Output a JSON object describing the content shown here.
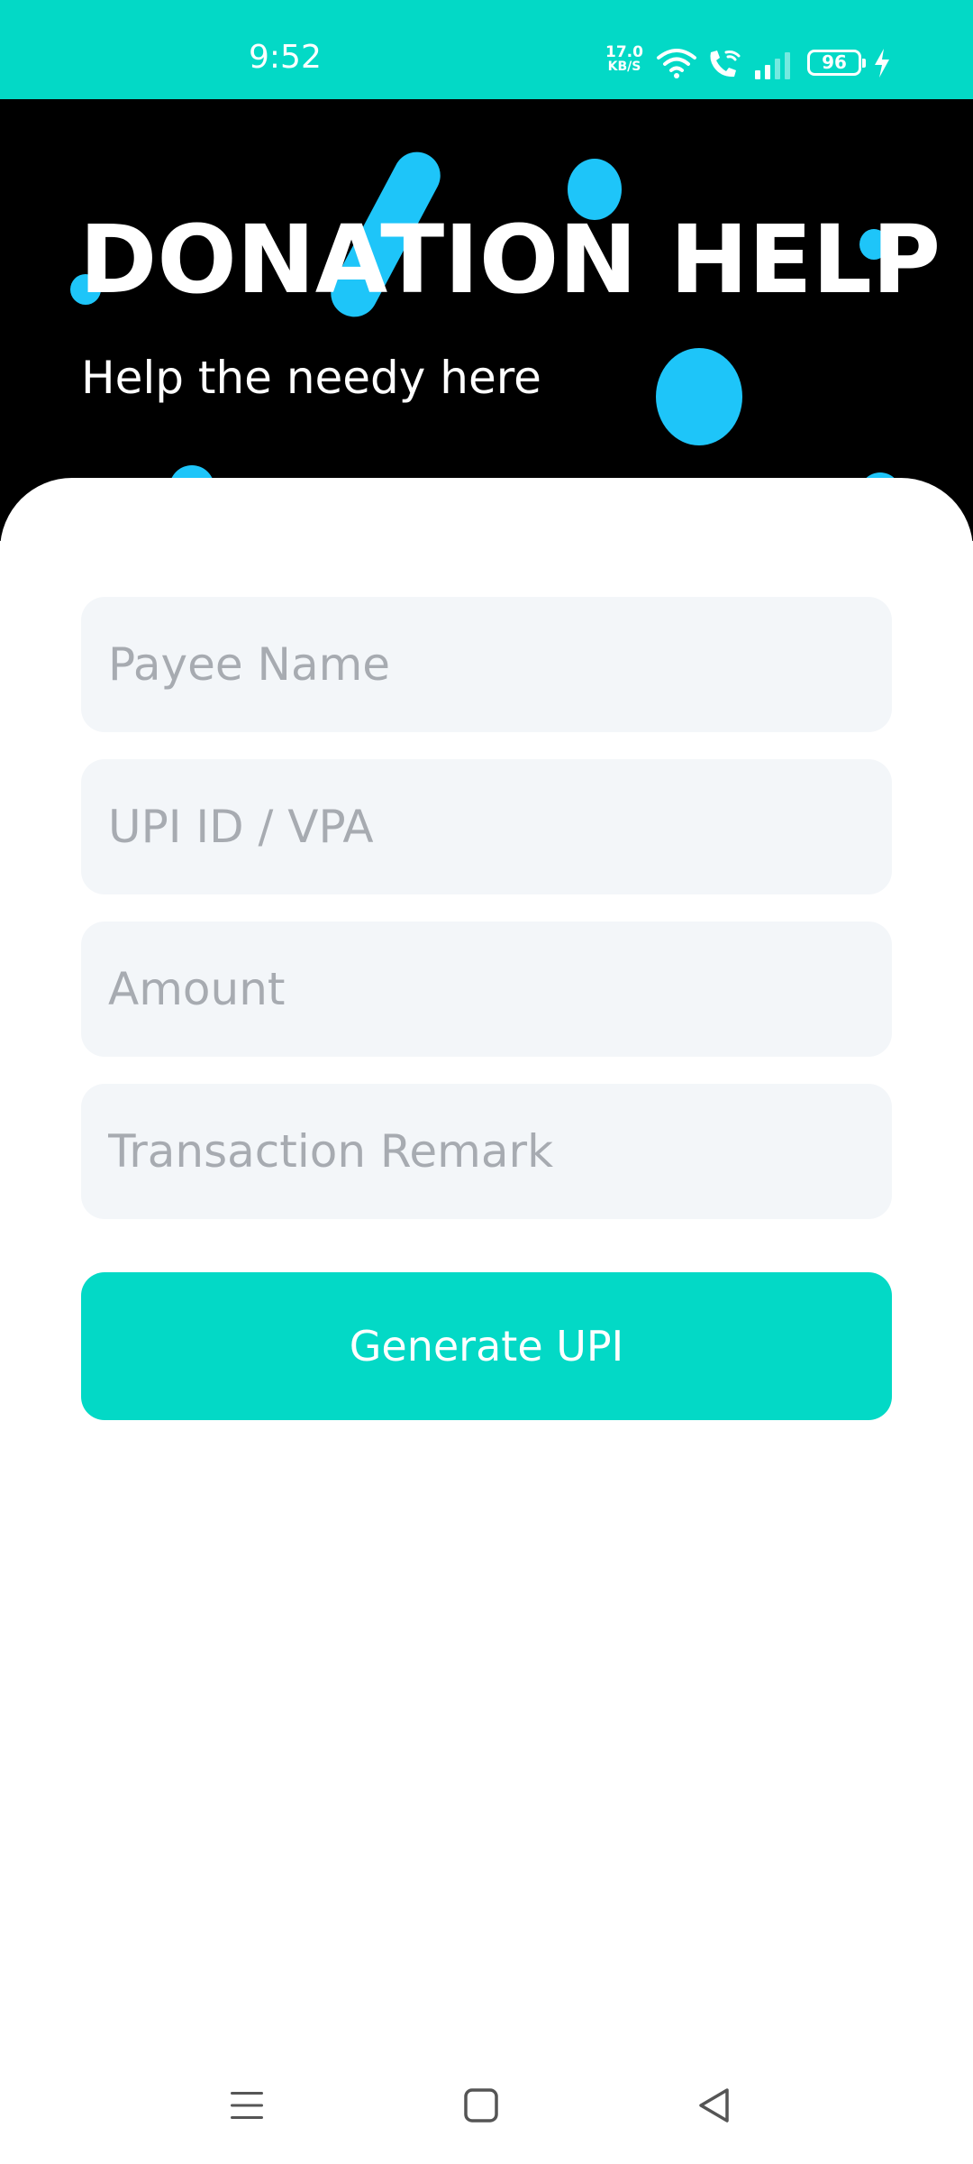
{
  "status_bar": {
    "time": "9:52",
    "network_speed": "17.0",
    "network_speed_unit": "KB/S",
    "battery_level": "96",
    "icons": [
      "wifi-icon",
      "wifi-call-icon",
      "signal-icon",
      "battery-icon",
      "charging-icon"
    ]
  },
  "header": {
    "title": "DONATION HELP",
    "subtitle": "Help the needy here"
  },
  "form": {
    "payee_name_placeholder": "Payee Name",
    "upi_id_placeholder": "UPI ID / VPA",
    "amount_placeholder": "Amount",
    "remark_placeholder": "Transaction Remark",
    "submit_label": "Generate UPI"
  },
  "nav_bar": {
    "icons": [
      "menu-icon",
      "home-icon",
      "back-icon"
    ]
  },
  "colors": {
    "accent": "#03d9c6",
    "header_background": "#000000",
    "decoration": "#1ec5f9",
    "field_background": "#f3f6f9",
    "placeholder": "#a7abb1"
  }
}
